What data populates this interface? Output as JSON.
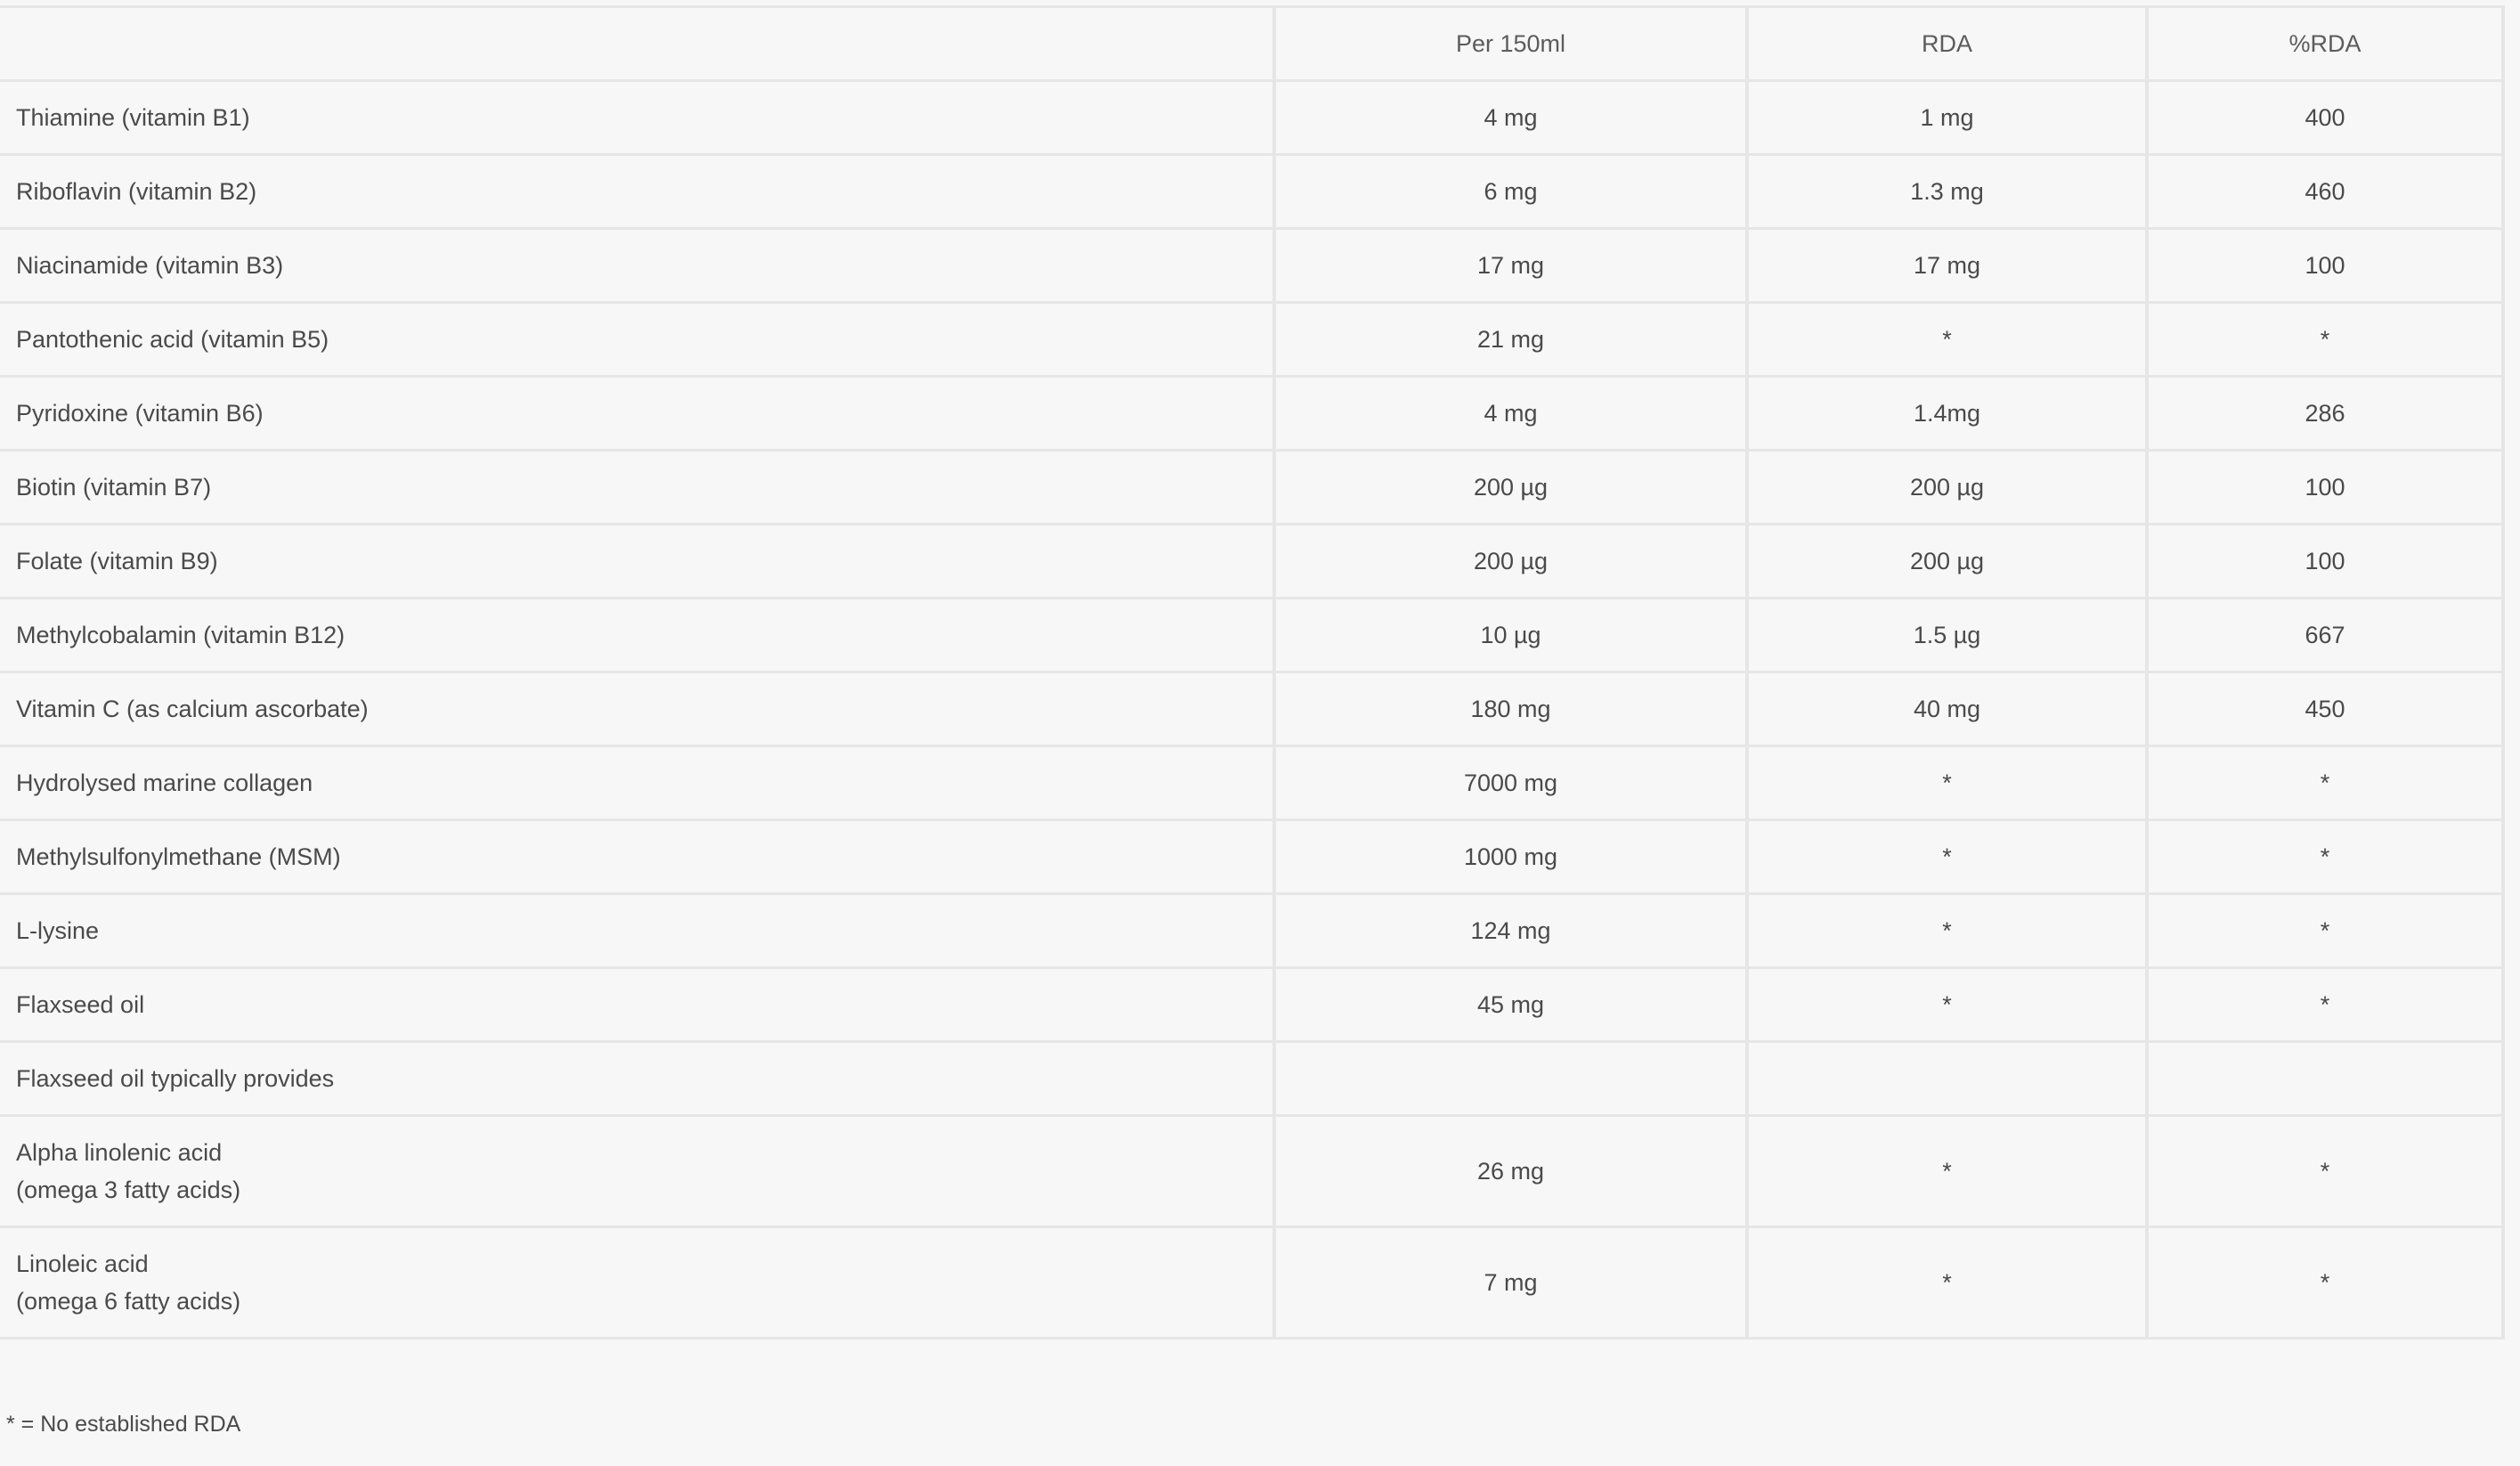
{
  "table": {
    "headers": [
      "",
      "Per 150ml",
      "RDA",
      "%RDA"
    ],
    "rows": [
      {
        "name": "Thiamine (vitamin B1)",
        "per": "4 mg",
        "rda": "1 mg",
        "pct": "400"
      },
      {
        "name": "Riboflavin (vitamin B2)",
        "per": "6 mg",
        "rda": "1.3 mg",
        "pct": "460"
      },
      {
        "name": "Niacinamide (vitamin B3)",
        "per": "17 mg",
        "rda": "17 mg",
        "pct": "100"
      },
      {
        "name": "Pantothenic acid (vitamin B5)",
        "per": "21 mg",
        "rda": "*",
        "pct": "*"
      },
      {
        "name": "Pyridoxine (vitamin B6)",
        "per": "4 mg",
        "rda": "1.4mg",
        "pct": "286"
      },
      {
        "name": "Biotin (vitamin B7)",
        "per": "200 µg",
        "rda": "200 µg",
        "pct": "100"
      },
      {
        "name": "Folate (vitamin B9)",
        "per": "200 µg",
        "rda": "200 µg",
        "pct": "100"
      },
      {
        "name": "Methylcobalamin (vitamin B12)",
        "per": "10 µg",
        "rda": "1.5 µg",
        "pct": "667"
      },
      {
        "name": "Vitamin C (as calcium ascorbate)",
        "per": "180 mg",
        "rda": "40 mg",
        "pct": "450"
      },
      {
        "name": "Hydrolysed marine collagen",
        "per": "7000 mg",
        "rda": "*",
        "pct": "*"
      },
      {
        "name": "Methylsulfonylmethane (MSM)",
        "per": "1000 mg",
        "rda": "*",
        "pct": "*"
      },
      {
        "name": "L-lysine",
        "per": "124 mg",
        "rda": "*",
        "pct": "*"
      },
      {
        "name": "Flaxseed oil",
        "per": "45 mg",
        "rda": "*",
        "pct": "*"
      },
      {
        "name": "Flaxseed oil typically provides",
        "per": "",
        "rda": "",
        "pct": ""
      },
      {
        "name_line1": "Alpha linolenic acid",
        "name_line2": "(omega 3 fatty acids)",
        "per": "26 mg",
        "rda": "*",
        "pct": "*"
      },
      {
        "name_line1": "Linoleic acid",
        "name_line2": "(omega 6 fatty acids)",
        "per": "7 mg",
        "rda": "*",
        "pct": "*"
      }
    ]
  },
  "footnote": "* = No established RDA"
}
